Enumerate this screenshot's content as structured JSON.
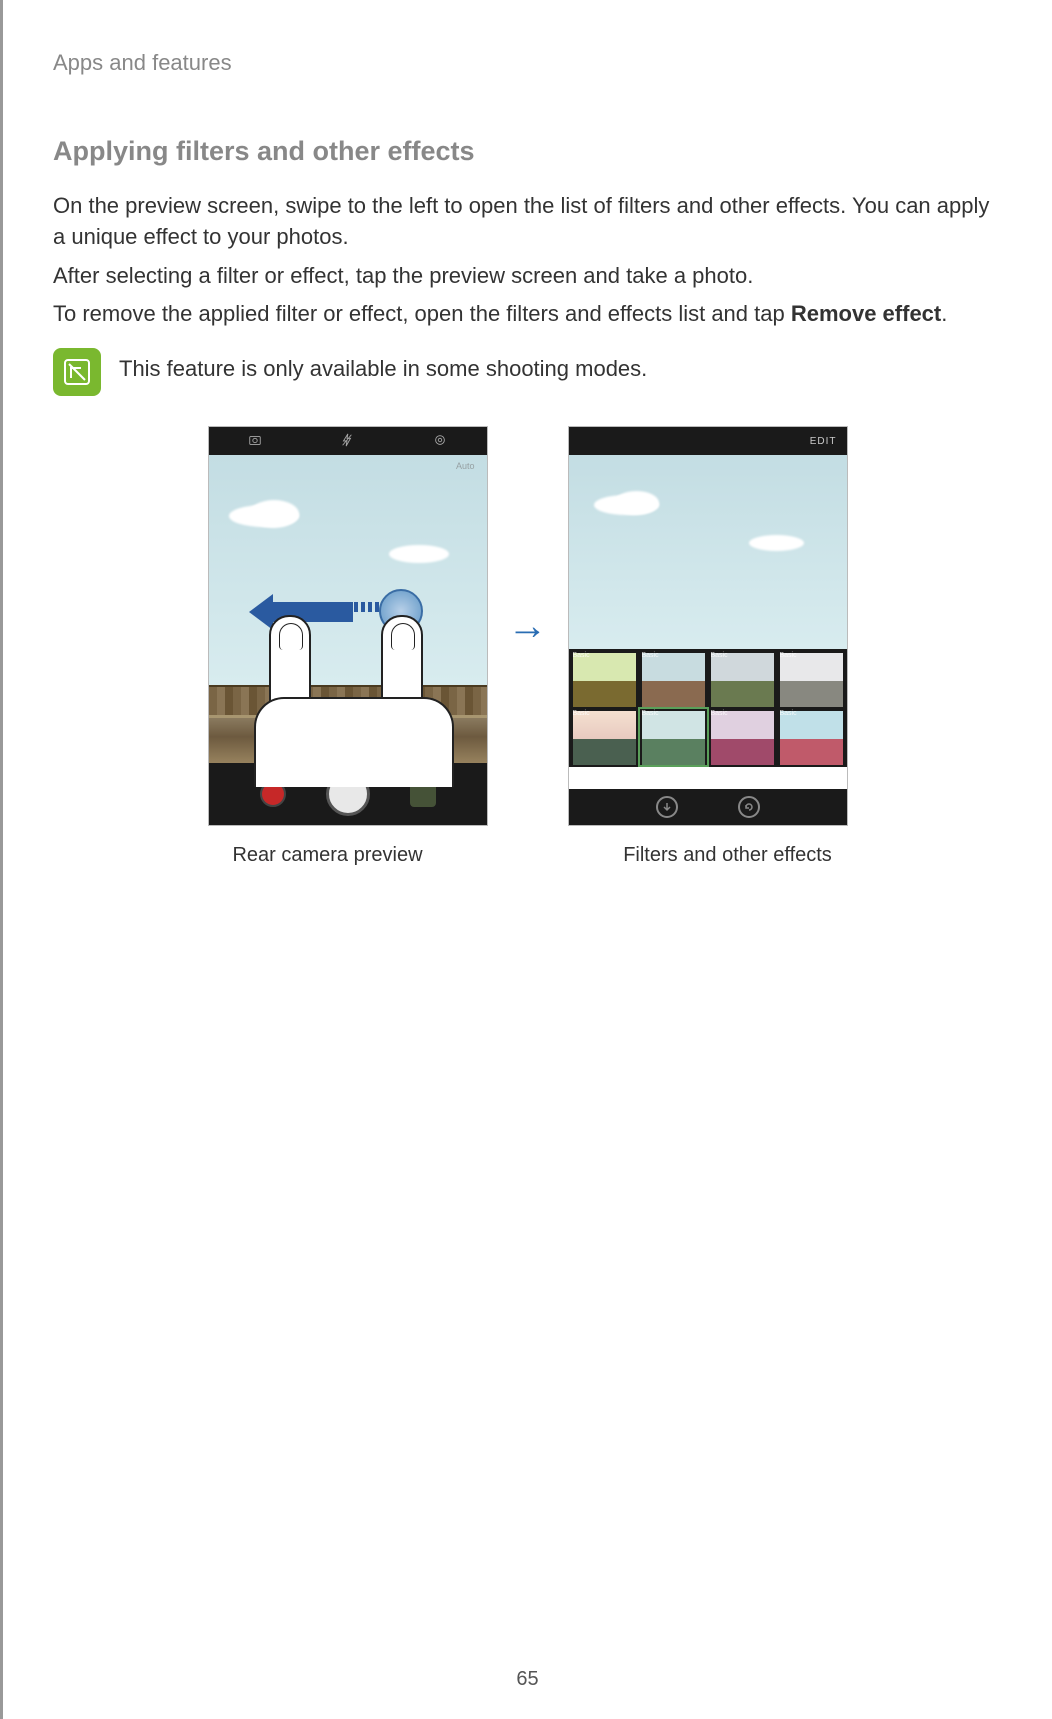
{
  "header": {
    "section": "Apps and features"
  },
  "title": "Applying filters and other effects",
  "paragraphs": {
    "p1": "On the preview screen, swipe to the left to open the list of filters and other effects. You can apply a unique effect to your photos.",
    "p2": "After selecting a filter or effect, tap the preview screen and take a photo.",
    "p3a": "To remove the applied filter or effect, open the filters and effects list and tap ",
    "p3b": "Remove effect",
    "p3c": "."
  },
  "note": "This feature is only available in some shooting modes.",
  "figures": {
    "left_caption": "Rear camera preview",
    "right_caption": "Filters and other effects",
    "edit_label": "EDIT",
    "mode_label": "Auto",
    "filter_labels": [
      "Basic",
      "Basic",
      "Basic",
      "Basic",
      "Basic",
      "Basic",
      "Basic",
      "Basic"
    ]
  },
  "page_number": "65"
}
